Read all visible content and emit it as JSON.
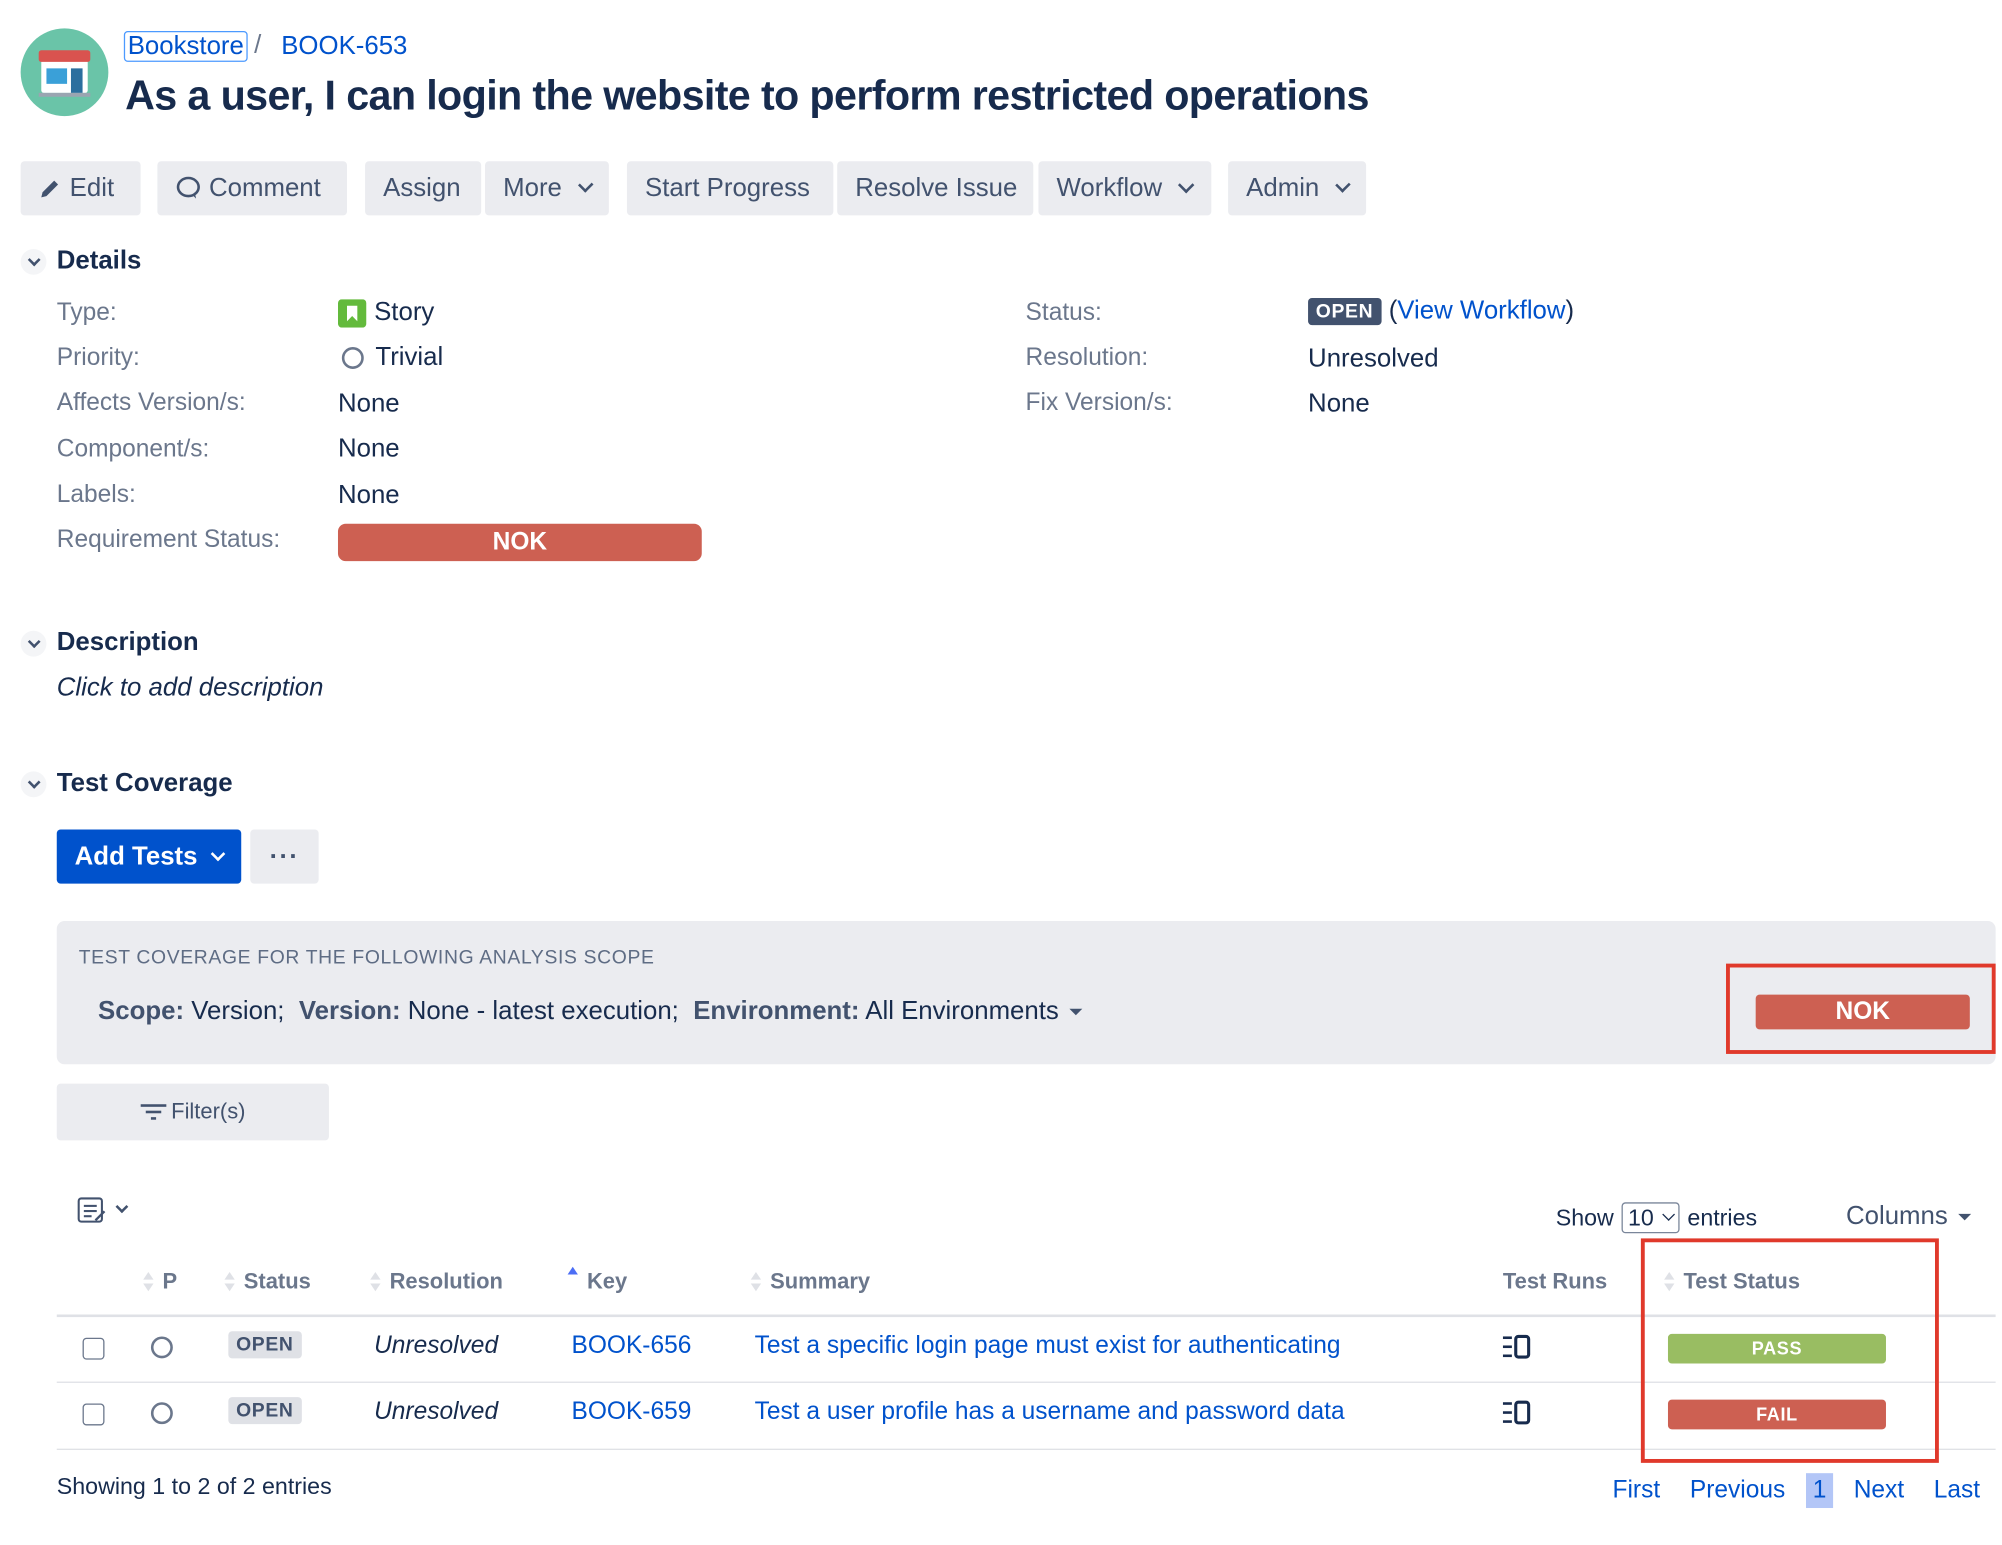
{
  "breadcrumb": {
    "project": "Bookstore",
    "separator": "/",
    "issue_key": "BOOK-653"
  },
  "issue": {
    "title": "As a user, I can login the website to perform restricted operations"
  },
  "toolbar": {
    "edit": "Edit",
    "comment": "Comment",
    "assign": "Assign",
    "more": "More",
    "start_progress": "Start Progress",
    "resolve_issue": "Resolve Issue",
    "workflow": "Workflow",
    "admin": "Admin"
  },
  "details": {
    "title": "Details",
    "type_label": "Type:",
    "type_value": "Story",
    "priority_label": "Priority:",
    "priority_value": "Trivial",
    "affects_label": "Affects Version/s:",
    "affects_value": "None",
    "components_label": "Component/s:",
    "components_value": "None",
    "labels_label": "Labels:",
    "labels_value": "None",
    "req_status_label": "Requirement Status:",
    "req_status_value": "NOK",
    "status_label": "Status:",
    "status_value": "OPEN",
    "view_workflow_open": "(",
    "view_workflow": "View Workflow",
    "view_workflow_close": ")",
    "resolution_label": "Resolution:",
    "resolution_value": "Unresolved",
    "fix_label": "Fix Version/s:",
    "fix_value": "None"
  },
  "description": {
    "title": "Description",
    "placeholder": "Click to add description"
  },
  "coverage": {
    "title": "Test Coverage",
    "add_tests": "Add Tests",
    "more": "···",
    "scope_heading": "TEST COVERAGE FOR THE FOLLOWING ANALYSIS SCOPE",
    "scope_label": "Scope:",
    "scope_value": "Version;",
    "version_label": "Version:",
    "version_value": "None - latest execution;",
    "env_label": "Environment:",
    "env_value": "All Environments",
    "status": "NOK",
    "filter": "Filter(s)"
  },
  "table": {
    "show_label": "Show",
    "page_size": "10",
    "entries_label": "entries",
    "columns_label": "Columns",
    "headers": {
      "p": "P",
      "status": "Status",
      "resolution": "Resolution",
      "key": "Key",
      "summary": "Summary",
      "test_runs": "Test Runs",
      "test_status": "Test Status"
    },
    "rows": [
      {
        "status": "OPEN",
        "resolution": "Unresolved",
        "key": "BOOK-656",
        "summary": "Test a specific login page must exist for authenticating",
        "test_status": "PASS",
        "test_status_color": "#99bd62"
      },
      {
        "status": "OPEN",
        "resolution": "Unresolved",
        "key": "BOOK-659",
        "summary": "Test a user profile has a username and password data",
        "test_status": "FAIL",
        "test_status_color": "#cd6052"
      }
    ],
    "footer": "Showing 1 to 2 of 2 entries"
  },
  "pagination": {
    "first": "First",
    "previous": "Previous",
    "current": "1",
    "next": "Next",
    "last": "Last"
  },
  "colors": {
    "accent": "#0052cc",
    "nok": "#cd6052",
    "pass": "#99bd62",
    "highlight": "#e0392b"
  }
}
